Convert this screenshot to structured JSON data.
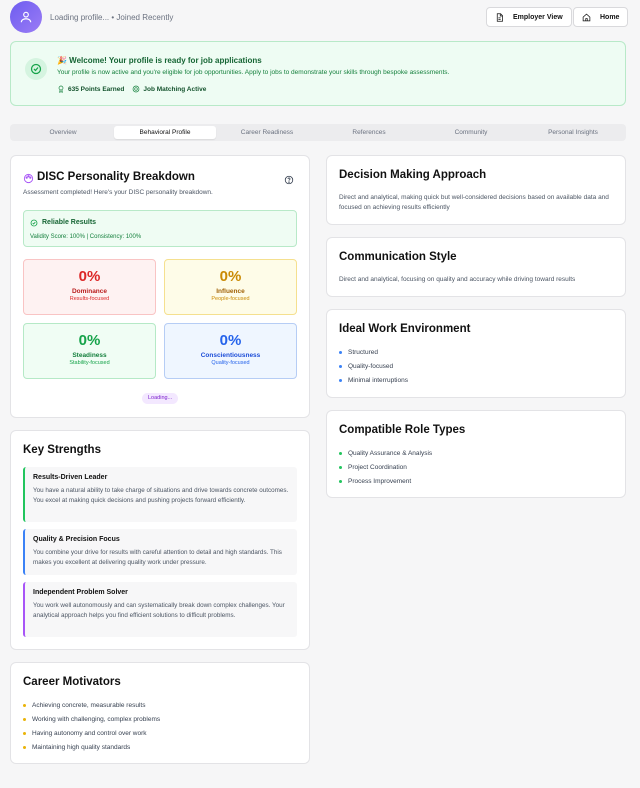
{
  "header": {
    "status_text": "Loading profile... • Joined Recently",
    "employer_view_label": "Employer View",
    "home_label": "Home"
  },
  "banner": {
    "title": "🎉 Welcome! Your profile is ready for job applications",
    "subtitle": "Your profile is now active and you're eligible for job opportunities. Apply to jobs to demonstrate your skills through bespoke assessments.",
    "points": "635 Points Earned",
    "matching": "Job Matching Active"
  },
  "tabs": [
    "Overview",
    "Behavioral Profile",
    "Career Readiness",
    "References",
    "Community",
    "Personal Insights"
  ],
  "active_tab": "Behavioral Profile",
  "disc": {
    "title": "DISC Personality Breakdown",
    "subtitle": "Assessment completed! Here's your DISC personality breakdown.",
    "reliable_title": "Reliable Results",
    "reliable_text": "Validity Score: 100% | Consistency: 100%",
    "loading_label": "Loading...",
    "traits": [
      {
        "percent": "0%",
        "name": "Dominance",
        "sub": "Results-focused",
        "color": "#dc2626",
        "bg": "#fef2f2",
        "border": "#f9c4c4"
      },
      {
        "percent": "0%",
        "name": "Influence",
        "sub": "People-focused",
        "color": "#ca8a04",
        "bg": "#fefce8",
        "border": "#f5e08f"
      },
      {
        "percent": "0%",
        "name": "Steadiness",
        "sub": "Stability-focused",
        "color": "#16a34a",
        "bg": "#f0fdf4",
        "border": "#b5e9c6"
      },
      {
        "percent": "0%",
        "name": "Conscientiousness",
        "sub": "Quality-focused",
        "color": "#2563eb",
        "bg": "#eff6ff",
        "border": "#b6cdf5"
      }
    ]
  },
  "strengths": {
    "title": "Key Strengths",
    "items": [
      {
        "title": "Results-Driven Leader",
        "text": "You have a natural ability to take charge of situations and drive towards concrete outcomes. You excel at making quick decisions and pushing projects forward efficiently.",
        "color": "#22c55e"
      },
      {
        "title": "Quality & Precision Focus",
        "text": "You combine your drive for results with careful attention to detail and high standards. This makes you excellent at delivering quality work under pressure.",
        "color": "#3b82f6"
      },
      {
        "title": "Independent Problem Solver",
        "text": "You work well autonomously and can systematically break down complex challenges. Your analytical approach helps you find efficient solutions to difficult problems.",
        "color": "#a855f7"
      }
    ]
  },
  "motivators": {
    "title": "Career Motivators",
    "items": [
      "Achieving concrete, measurable results",
      "Working with challenging, complex problems",
      "Having autonomy and control over work",
      "Maintaining high quality standards"
    ]
  },
  "decision": {
    "title": "Decision Making Approach",
    "text": "Direct and analytical, making quick but well-considered decisions based on available data and focused on achieving results efficiently"
  },
  "communication": {
    "title": "Communication Style",
    "text": "Direct and analytical, focusing on quality and accuracy while driving toward results"
  },
  "environment": {
    "title": "Ideal Work Environment",
    "items": [
      "Structured",
      "Quality-focused",
      "Minimal interruptions"
    ]
  },
  "roles": {
    "title": "Compatible Role Types",
    "items": [
      "Quality Assurance & Analysis",
      "Project Coordination",
      "Process Improvement"
    ]
  }
}
